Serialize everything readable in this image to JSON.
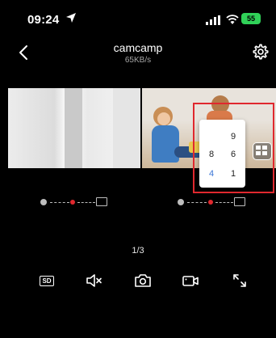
{
  "status": {
    "time": "09:24",
    "battery": "55"
  },
  "header": {
    "title": "camcamp",
    "speed": "65KB/s"
  },
  "layout_menu": {
    "options": [
      {
        "label": "9",
        "selected": false
      },
      {
        "label": "8",
        "selected": false
      },
      {
        "label": "6",
        "selected": false
      },
      {
        "label": "4",
        "selected": true
      },
      {
        "label": "1",
        "selected": false
      }
    ],
    "selected_color": "#3b76d6",
    "highlight_color": "#e0282e"
  },
  "pager": {
    "text": "1/3"
  },
  "controls": {
    "quality_label": "SD",
    "icons": [
      "sd-quality-icon",
      "mute-icon",
      "snapshot-camera-icon",
      "record-video-icon",
      "fullscreen-icon"
    ]
  }
}
